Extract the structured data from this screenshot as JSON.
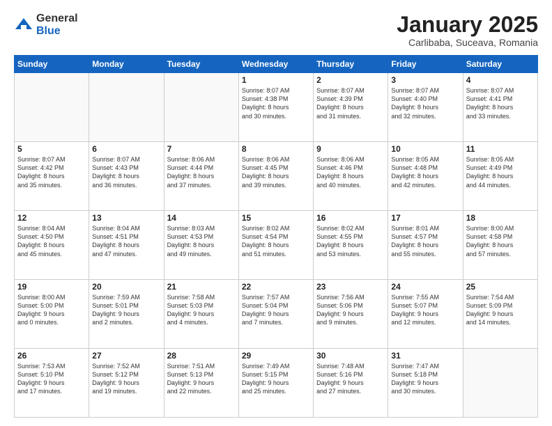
{
  "logo": {
    "general": "General",
    "blue": "Blue"
  },
  "header": {
    "month": "January 2025",
    "location": "Carlibaba, Suceava, Romania"
  },
  "weekdays": [
    "Sunday",
    "Monday",
    "Tuesday",
    "Wednesday",
    "Thursday",
    "Friday",
    "Saturday"
  ],
  "weeks": [
    [
      {
        "day": "",
        "content": ""
      },
      {
        "day": "",
        "content": ""
      },
      {
        "day": "",
        "content": ""
      },
      {
        "day": "1",
        "content": "Sunrise: 8:07 AM\nSunset: 4:38 PM\nDaylight: 8 hours\nand 30 minutes."
      },
      {
        "day": "2",
        "content": "Sunrise: 8:07 AM\nSunset: 4:39 PM\nDaylight: 8 hours\nand 31 minutes."
      },
      {
        "day": "3",
        "content": "Sunrise: 8:07 AM\nSunset: 4:40 PM\nDaylight: 8 hours\nand 32 minutes."
      },
      {
        "day": "4",
        "content": "Sunrise: 8:07 AM\nSunset: 4:41 PM\nDaylight: 8 hours\nand 33 minutes."
      }
    ],
    [
      {
        "day": "5",
        "content": "Sunrise: 8:07 AM\nSunset: 4:42 PM\nDaylight: 8 hours\nand 35 minutes."
      },
      {
        "day": "6",
        "content": "Sunrise: 8:07 AM\nSunset: 4:43 PM\nDaylight: 8 hours\nand 36 minutes."
      },
      {
        "day": "7",
        "content": "Sunrise: 8:06 AM\nSunset: 4:44 PM\nDaylight: 8 hours\nand 37 minutes."
      },
      {
        "day": "8",
        "content": "Sunrise: 8:06 AM\nSunset: 4:45 PM\nDaylight: 8 hours\nand 39 minutes."
      },
      {
        "day": "9",
        "content": "Sunrise: 8:06 AM\nSunset: 4:46 PM\nDaylight: 8 hours\nand 40 minutes."
      },
      {
        "day": "10",
        "content": "Sunrise: 8:05 AM\nSunset: 4:48 PM\nDaylight: 8 hours\nand 42 minutes."
      },
      {
        "day": "11",
        "content": "Sunrise: 8:05 AM\nSunset: 4:49 PM\nDaylight: 8 hours\nand 44 minutes."
      }
    ],
    [
      {
        "day": "12",
        "content": "Sunrise: 8:04 AM\nSunset: 4:50 PM\nDaylight: 8 hours\nand 45 minutes."
      },
      {
        "day": "13",
        "content": "Sunrise: 8:04 AM\nSunset: 4:51 PM\nDaylight: 8 hours\nand 47 minutes."
      },
      {
        "day": "14",
        "content": "Sunrise: 8:03 AM\nSunset: 4:53 PM\nDaylight: 8 hours\nand 49 minutes."
      },
      {
        "day": "15",
        "content": "Sunrise: 8:02 AM\nSunset: 4:54 PM\nDaylight: 8 hours\nand 51 minutes."
      },
      {
        "day": "16",
        "content": "Sunrise: 8:02 AM\nSunset: 4:55 PM\nDaylight: 8 hours\nand 53 minutes."
      },
      {
        "day": "17",
        "content": "Sunrise: 8:01 AM\nSunset: 4:57 PM\nDaylight: 8 hours\nand 55 minutes."
      },
      {
        "day": "18",
        "content": "Sunrise: 8:00 AM\nSunset: 4:58 PM\nDaylight: 8 hours\nand 57 minutes."
      }
    ],
    [
      {
        "day": "19",
        "content": "Sunrise: 8:00 AM\nSunset: 5:00 PM\nDaylight: 9 hours\nand 0 minutes."
      },
      {
        "day": "20",
        "content": "Sunrise: 7:59 AM\nSunset: 5:01 PM\nDaylight: 9 hours\nand 2 minutes."
      },
      {
        "day": "21",
        "content": "Sunrise: 7:58 AM\nSunset: 5:03 PM\nDaylight: 9 hours\nand 4 minutes."
      },
      {
        "day": "22",
        "content": "Sunrise: 7:57 AM\nSunset: 5:04 PM\nDaylight: 9 hours\nand 7 minutes."
      },
      {
        "day": "23",
        "content": "Sunrise: 7:56 AM\nSunset: 5:06 PM\nDaylight: 9 hours\nand 9 minutes."
      },
      {
        "day": "24",
        "content": "Sunrise: 7:55 AM\nSunset: 5:07 PM\nDaylight: 9 hours\nand 12 minutes."
      },
      {
        "day": "25",
        "content": "Sunrise: 7:54 AM\nSunset: 5:09 PM\nDaylight: 9 hours\nand 14 minutes."
      }
    ],
    [
      {
        "day": "26",
        "content": "Sunrise: 7:53 AM\nSunset: 5:10 PM\nDaylight: 9 hours\nand 17 minutes."
      },
      {
        "day": "27",
        "content": "Sunrise: 7:52 AM\nSunset: 5:12 PM\nDaylight: 9 hours\nand 19 minutes."
      },
      {
        "day": "28",
        "content": "Sunrise: 7:51 AM\nSunset: 5:13 PM\nDaylight: 9 hours\nand 22 minutes."
      },
      {
        "day": "29",
        "content": "Sunrise: 7:49 AM\nSunset: 5:15 PM\nDaylight: 9 hours\nand 25 minutes."
      },
      {
        "day": "30",
        "content": "Sunrise: 7:48 AM\nSunset: 5:16 PM\nDaylight: 9 hours\nand 27 minutes."
      },
      {
        "day": "31",
        "content": "Sunrise: 7:47 AM\nSunset: 5:18 PM\nDaylight: 9 hours\nand 30 minutes."
      },
      {
        "day": "",
        "content": ""
      }
    ]
  ]
}
